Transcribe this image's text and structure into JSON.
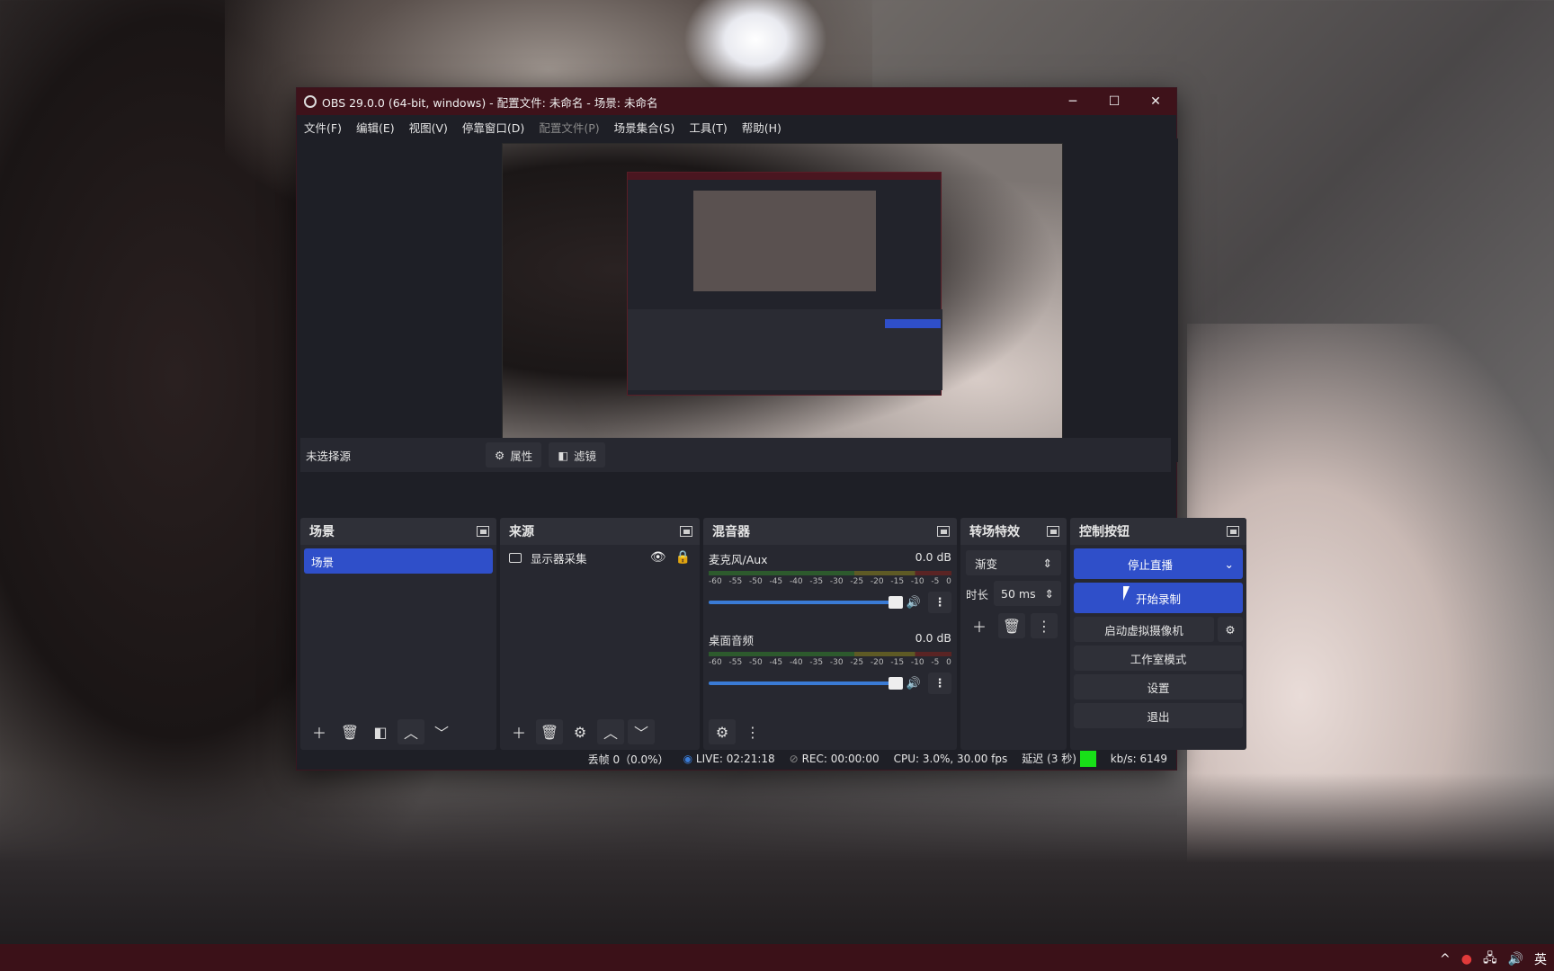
{
  "window": {
    "title": "OBS 29.0.0 (64-bit, windows) - 配置文件: 未命名 - 场景: 未命名",
    "minimize": "─",
    "maximize": "☐",
    "close": "✕"
  },
  "menu": {
    "file": "文件(F)",
    "edit": "编辑(E)",
    "view": "视图(V)",
    "docks": "停靠窗口(D)",
    "profile": "配置文件(P)",
    "scene_collection": "场景集合(S)",
    "tools": "工具(T)",
    "help": "帮助(H)"
  },
  "context_bar": {
    "no_source": "未选择源",
    "properties": "属性",
    "filters": "滤镜"
  },
  "scenes": {
    "title": "场景",
    "items": [
      "场景"
    ]
  },
  "sources": {
    "title": "来源",
    "items": [
      "显示器采集"
    ]
  },
  "mixer": {
    "title": "混音器",
    "channels": [
      {
        "name": "麦克风/Aux",
        "db": "0.0 dB",
        "volume_fraction": 1.0
      },
      {
        "name": "桌面音频",
        "db": "0.0 dB",
        "volume_fraction": 1.0
      }
    ],
    "ticks": [
      "-60",
      "-55",
      "-50",
      "-45",
      "-40",
      "-35",
      "-30",
      "-25",
      "-20",
      "-15",
      "-10",
      "-5",
      "0"
    ]
  },
  "transitions": {
    "title": "转场特效",
    "selected": "渐变",
    "duration_label": "时长",
    "duration_value": "50 ms"
  },
  "controls": {
    "title": "控制按钮",
    "stop_stream": "停止直播",
    "start_record": "开始录制",
    "virtual_cam": "启动虚拟摄像机",
    "studio_mode": "工作室模式",
    "settings": "设置",
    "exit": "退出"
  },
  "status": {
    "dropped": "丢帧 0（0.0%）",
    "live": "LIVE: 02:21:18",
    "rec": "REC: 00:00:00",
    "cpu": "CPU: 3.0%, 30.00 fps",
    "delay": "延迟 (3 秒)",
    "kbs": "kb/s: 6149",
    "health_color": "#18e018"
  },
  "taskbar": {
    "ime": "英"
  },
  "colors": {
    "accent": "#2f4fc9",
    "titlebar": "#3e121a"
  }
}
